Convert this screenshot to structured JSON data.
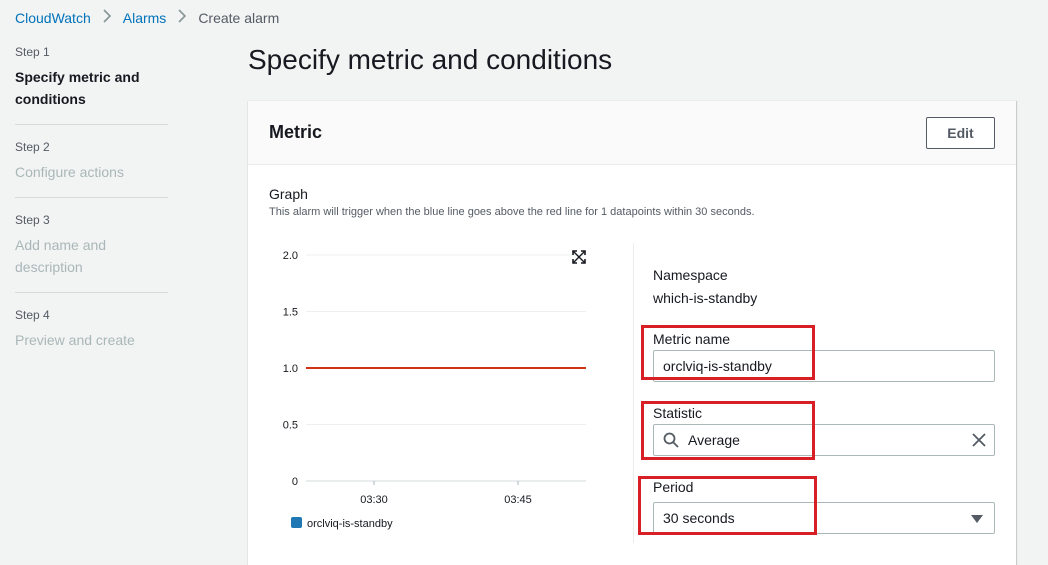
{
  "breadcrumb": {
    "items": [
      "CloudWatch",
      "Alarms"
    ],
    "current": "Create alarm"
  },
  "steps": [
    {
      "number": "Step 1",
      "title": "Specify metric and conditions",
      "active": true
    },
    {
      "number": "Step 2",
      "title": "Configure actions",
      "active": false
    },
    {
      "number": "Step 3",
      "title": "Add name and description",
      "active": false
    },
    {
      "number": "Step 4",
      "title": "Preview and create",
      "active": false
    }
  ],
  "page": {
    "title": "Specify metric and conditions"
  },
  "metric_panel": {
    "title": "Metric",
    "edit_label": "Edit",
    "graph_label": "Graph",
    "graph_description": "This alarm will trigger when the blue line goes above the red line for 1 datapoints within 30 seconds.",
    "namespace_label": "Namespace",
    "namespace_value": "which-is-standby",
    "metric_name_label": "Metric name",
    "metric_name_value": "orclviq-is-standby",
    "statistic_label": "Statistic",
    "statistic_value": "Average",
    "period_label": "Period",
    "period_value": "30 seconds"
  },
  "colors": {
    "accent": "#0073bb",
    "threshold": "#d13212",
    "series": "#1f77b4",
    "highlight": "#d91f26"
  },
  "chart_data": {
    "type": "line",
    "y_ticks": [
      "2.0",
      "1.5",
      "1.0",
      "0.5",
      "0"
    ],
    "x_ticks": [
      "03:30",
      "03:45"
    ],
    "ylim": [
      0,
      2
    ],
    "threshold": 1.0,
    "legend": [
      {
        "name": "orclviq-is-standby",
        "color": "#1f77b4"
      }
    ]
  }
}
